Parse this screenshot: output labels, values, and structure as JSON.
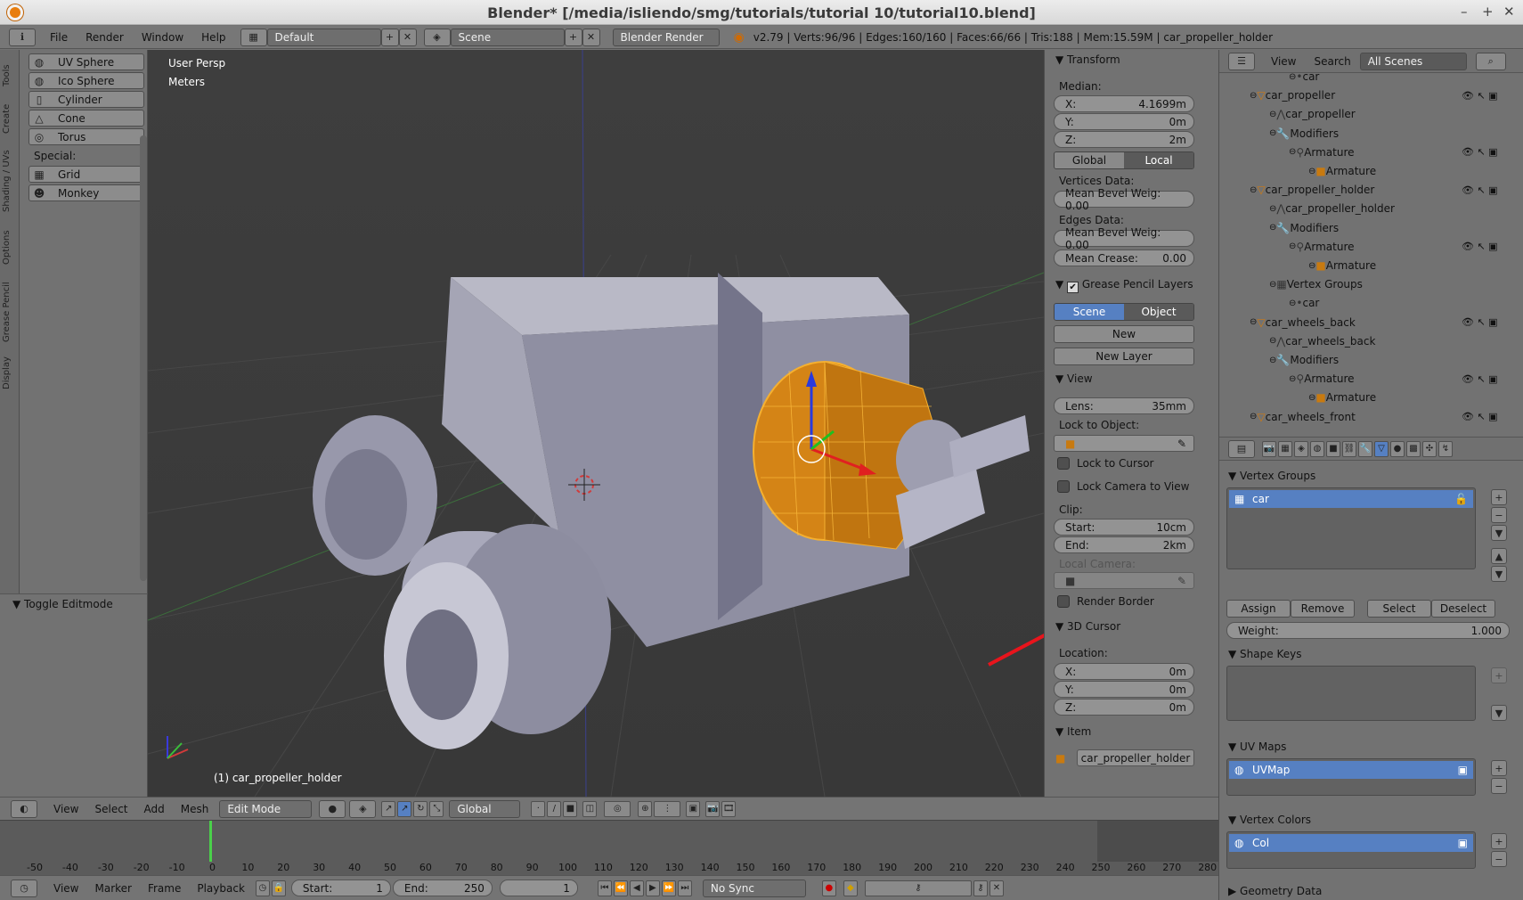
{
  "window_title": "Blender* [/media/isliendo/smg/tutorials/tutorial 10/tutorial10.blend]",
  "menu": [
    "File",
    "Render",
    "Window",
    "Help"
  ],
  "layout": "Default",
  "scene": "Scene",
  "engine": "Blender Render",
  "stats": "v2.79 | Verts:96/96 | Edges:160/160 | Faces:66/66 | Tris:188 | Mem:15.59M | car_propeller_holder",
  "left_tabs": [
    "Tools",
    "Create",
    "Shading / UVs",
    "Options",
    "Grease Pencil",
    "Display"
  ],
  "tools": {
    "items": [
      "UV Sphere",
      "Ico Sphere",
      "Cylinder",
      "Cone",
      "Torus"
    ],
    "special_label": "Special:",
    "special": [
      "Grid",
      "Monkey"
    ],
    "operator": "Toggle Editmode"
  },
  "viewport": {
    "persp": "User Persp",
    "units": "Meters",
    "object_label": "(1) car_propeller_holder"
  },
  "npanel": {
    "transform": "Transform",
    "median": "Median:",
    "x_label": "X:",
    "x": "4.1699m",
    "y_label": "Y:",
    "y": "0m",
    "z_label": "Z:",
    "z": "2m",
    "global": "Global",
    "local": "Local",
    "vertices_data": "Vertices Data:",
    "vert_bevel": "Mean Bevel Weig: 0.00",
    "edges_data": "Edges Data:",
    "edge_bevel": "Mean Bevel Weig: 0.00",
    "crease_label": "Mean Crease:",
    "crease": "0.00",
    "gp_layers": "Grease Pencil Layers",
    "gp_scene": "Scene",
    "gp_object": "Object",
    "gp_new": "New",
    "gp_new_layer": "New Layer",
    "view": "View",
    "lens_label": "Lens:",
    "lens": "35mm",
    "lock_object": "Lock to Object:",
    "lock_cursor": "Lock to Cursor",
    "lock_camera": "Lock Camera to View",
    "clip": "Clip:",
    "start_label": "Start:",
    "start": "10cm",
    "end_label": "End:",
    "end": "2km",
    "local_camera": "Local Camera:",
    "render_border": "Render Border",
    "cursor": "3D Cursor",
    "location": "Location:",
    "cx_label": "X:",
    "cx": "0m",
    "cy_label": "Y:",
    "cy": "0m",
    "cz_label": "Z:",
    "cz": "0m",
    "item": "Item",
    "item_name": "car_propeller_holder"
  },
  "outliner": {
    "view": "View",
    "search": "Search",
    "scenes": "All Scenes",
    "rows": [
      "car",
      "car_propeller",
      "car_propeller",
      "Modifiers",
      "Armature",
      "Armature",
      "car_propeller_holder",
      "car_propeller_holder",
      "Modifiers",
      "Armature",
      "Armature",
      "Vertex Groups",
      "car",
      "car_wheels_back",
      "car_wheels_back",
      "Modifiers",
      "Armature",
      "Armature",
      "car_wheels_front"
    ]
  },
  "props": {
    "vertex_groups": "Vertex Groups",
    "vg_item": "car",
    "assign": "Assign",
    "remove": "Remove",
    "select": "Select",
    "deselect": "Deselect",
    "weight_label": "Weight:",
    "weight": "1.000",
    "shape_keys": "Shape Keys",
    "uv_maps": "UV Maps",
    "uv_item": "UVMap",
    "vertex_colors": "Vertex Colors",
    "vc_item": "Col",
    "geometry_data": "Geometry Data"
  },
  "view3d_header": {
    "view": "View",
    "select": "Select",
    "add": "Add",
    "mesh": "Mesh",
    "mode": "Edit Mode",
    "orientation": "Global"
  },
  "timeline_ticks": [
    "-50",
    "-40",
    "-30",
    "-20",
    "-10",
    "0",
    "10",
    "20",
    "30",
    "40",
    "50",
    "60",
    "70",
    "80",
    "90",
    "100",
    "110",
    "120",
    "130",
    "140",
    "150",
    "160",
    "170",
    "180",
    "190",
    "200",
    "210",
    "220",
    "230",
    "240",
    "250",
    "260",
    "270",
    "280"
  ],
  "timeline_header": {
    "view": "View",
    "marker": "Marker",
    "frame": "Frame",
    "playback": "Playback",
    "start_label": "Start:",
    "start": "1",
    "end_label": "End:",
    "end": "250",
    "current": "1",
    "sync": "No Sync"
  },
  "colors": {
    "accent": "#5680c2",
    "selection": "#f0a020",
    "arrow": "#e8141c",
    "playhead": "#4ad04a"
  }
}
